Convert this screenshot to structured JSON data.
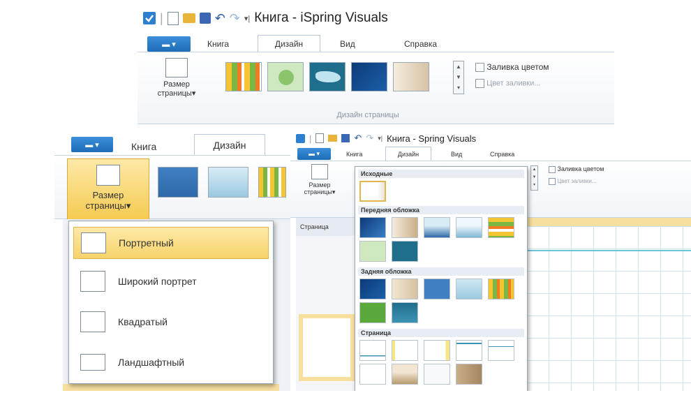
{
  "top_window": {
    "title": "Книга - iSpring Visuals",
    "tabs": [
      "Книга",
      "Дизайн",
      "Вид",
      "Справка"
    ],
    "active_tab": "Дизайн",
    "page_size": {
      "line1": "Размер",
      "line2": "страницы"
    },
    "fill_color_label": "Заливка цветом",
    "fill_color2_label": "Цвет заливки...",
    "group_label": "Дизайн страницы"
  },
  "left_window": {
    "tabs": [
      "Книга",
      "Дизайн"
    ],
    "active_tab": "Дизайн",
    "page_size": {
      "line1": "Размер",
      "line2": "страницы"
    },
    "menu_items": [
      "Портретный",
      "Широкий портрет",
      "Квадратый",
      "Ландшафтный"
    ],
    "highlighted_item": "Портретный"
  },
  "right_window": {
    "title": "Книга - Spring Visuals",
    "tabs": [
      "Книга",
      "Дизайн",
      "Вид",
      "Справка"
    ],
    "active_tab": "Дизайн",
    "page_size": {
      "line1": "Размер",
      "line2": "страницы"
    },
    "fill_color_label": "Заливка цветом",
    "fill_color2_label": "Цвет заливки...",
    "page_tab_label": "Страница",
    "gallery_sections": [
      "Исходные",
      "Передняя обложка",
      "Задняя обложка",
      "Страница"
    ]
  },
  "colors": {
    "accent": "#1e6cb8",
    "highlight": "#f7d36a",
    "ribbon_border": "#c5d3e2"
  }
}
